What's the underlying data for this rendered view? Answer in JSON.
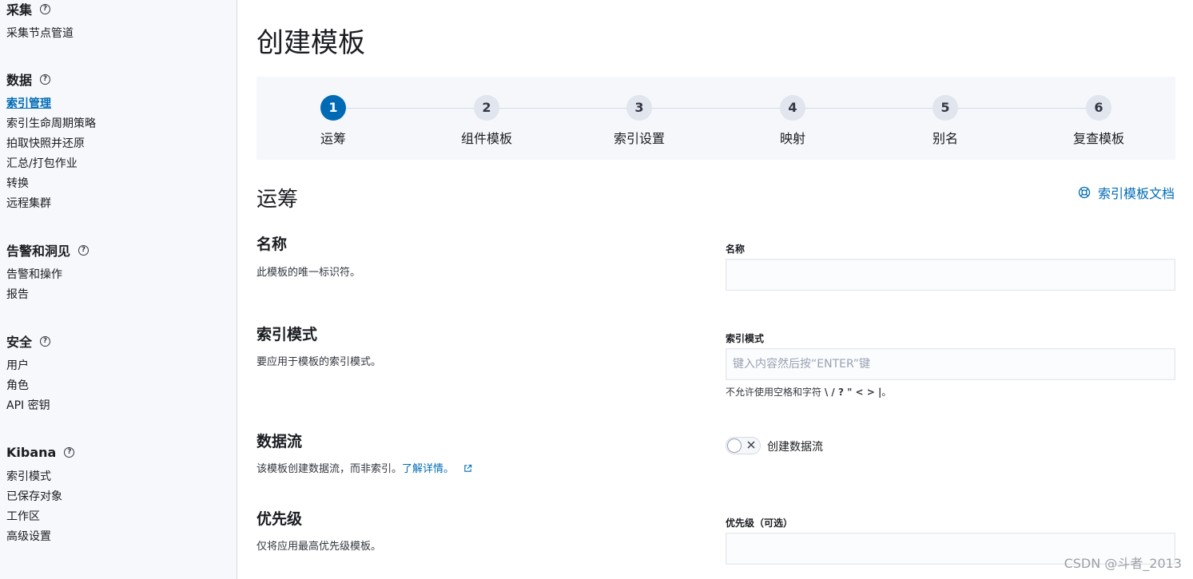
{
  "sidebar": {
    "groups": [
      {
        "title": "采集",
        "items": [
          "采集节点管道"
        ]
      },
      {
        "title": "数据",
        "items": [
          "索引管理",
          "索引生命周期策略",
          "拍取快照并还原",
          "汇总/打包作业",
          "转换",
          "远程集群"
        ],
        "active_item": "索引管理"
      },
      {
        "title": "告警和洞见",
        "items": [
          "告警和操作",
          "报告"
        ]
      },
      {
        "title": "安全",
        "items": [
          "用户",
          "角色",
          "API 密钥"
        ]
      },
      {
        "title": "Kibana",
        "items": [
          "索引模式",
          "已保存对象",
          "工作区",
          "高级设置"
        ]
      }
    ],
    "help_glyph": "?"
  },
  "main": {
    "title": "创建模板",
    "steps": [
      {
        "number": "1",
        "label": "运筹",
        "current": true
      },
      {
        "number": "2",
        "label": "组件模板"
      },
      {
        "number": "3",
        "label": "索引设置"
      },
      {
        "number": "4",
        "label": "映射"
      },
      {
        "number": "5",
        "label": "别名"
      },
      {
        "number": "6",
        "label": "复查模板"
      }
    ],
    "section_title": "运筹",
    "doc_link": "索引模板文档",
    "fields": {
      "name": {
        "title": "名称",
        "desc": "此模板的唯一标识符。",
        "label": "名称",
        "value": ""
      },
      "index_pattern": {
        "title": "索引模式",
        "desc": "要应用于模板的索引模式。",
        "label": "索引模式",
        "placeholder": "键入内容然后按“ENTER”键",
        "help_prefix": "不允许使用空格和字符 ",
        "help_chars": "\\ / ? \" < > |",
        "help_suffix": "。"
      },
      "data_stream": {
        "title": "数据流",
        "desc": "该模板创建数据流，而非索引。",
        "desc_link": "了解详情。",
        "toggle_label": "创建数据流",
        "enabled": false
      },
      "priority": {
        "title": "优先级",
        "desc": "仅将应用最高优先级模板。",
        "label": "优先级（可选）",
        "value": ""
      }
    }
  },
  "watermark": "CSDN @斗者_2013",
  "colors": {
    "accent": "#006bb4",
    "sidebar_bg": "#f7f8fc",
    "steps_bg": "#f5f7fa"
  },
  "icons": {
    "help": "help-icon",
    "doc": "lifebuoy-icon",
    "external": "external-link-icon",
    "toggle_off": "cross-icon"
  }
}
